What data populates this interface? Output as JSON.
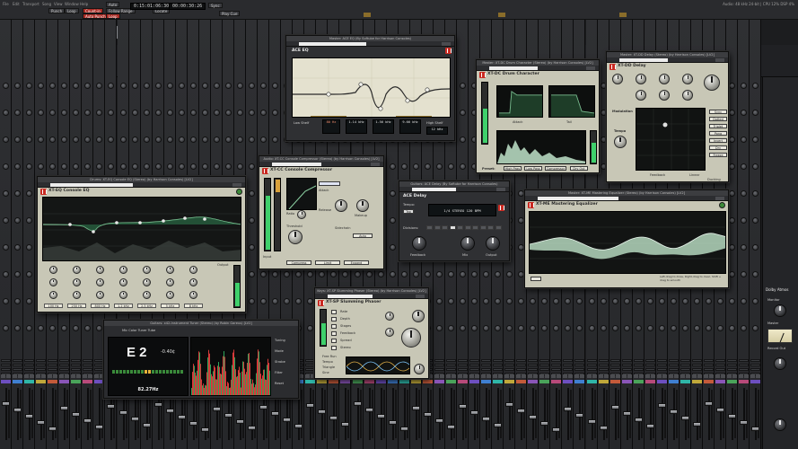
{
  "transport": {
    "menu": [
      "File",
      "Edit",
      "Transport",
      "Song",
      "View",
      "Window",
      "Help"
    ],
    "buttons": [
      "Punch",
      "Loop",
      "Count-in",
      "Auto",
      "Follow Range",
      "Auto Punch",
      "Loop",
      "Locate"
    ],
    "timecode": "0:15:01:06:30",
    "counter": "00:00:30:26",
    "sync_label": "Sync",
    "play_label": "Play Cue",
    "status_right": "Audio: 48 kHz 24-bit  |  CPU 12%   DSP 4%"
  },
  "plugins": {
    "ace_eq": {
      "title": "Master: ACE EQ (By Softube for Harrison Consoles)",
      "name": "ACE EQ",
      "bands": [
        "Low Shelf",
        "Bell",
        "Bell",
        "Bell",
        "High Shelf"
      ],
      "freqs": [
        "80 Hz",
        "1.14 kHz",
        "1.56 kHz",
        "9.66 kHz",
        "12 kHz"
      ]
    },
    "xt_dc": {
      "title": "Master: XT-DC Drum Character (Stereo) (by Harrison Consoles) [LV2]",
      "name": "XT-DC Drum Character",
      "labels": [
        "Attack",
        "Tail",
        "Preset:"
      ],
      "buttons": [
        "High Pass",
        "Low Pass",
        "Compressor",
        "Dry Out"
      ]
    },
    "xt_dd": {
      "title": "Master: XT-DD Delay (Stereo) (by Harrison Consoles) [LV2]",
      "name": "XT-DD Delay",
      "labels": [
        "Modulation",
        "Tempo",
        "Feedback",
        "Linear",
        "Ducking"
      ],
      "side_buttons": [
        "Sync",
        "Dotted",
        "Triplet",
        "Pong",
        "Invert",
        "Dry",
        "Freeze"
      ]
    },
    "xt_cc": {
      "title": "Audio: XT-CC Console Compressor (Stereo) (by Harrison Consoles) [LV2]",
      "name": "XT-CC Console Compressor",
      "labels": [
        "Ratio",
        "Attack",
        "Release",
        "Makeup",
        "Input",
        "Threshold",
        "Sidechain",
        "Auto"
      ],
      "footer": [
        "Compress",
        "Limit",
        "Expand"
      ]
    },
    "xt_eq": {
      "title": "Drums: XT-EQ Console EQ (Stereo) (by Harrison Consoles) [LV2]",
      "name": "XT-EQ Console EQ",
      "band_values": [
        "100 Hz",
        "250 Hz",
        "800 Hz",
        "1.2 kHz",
        "2.5 kHz",
        "5 kHz",
        "8 kHz",
        "12 kHz",
        "16 kHz",
        "18 kHz"
      ],
      "output_label": "Output"
    },
    "ace_delay": {
      "title": "Guitars: ACE Delay (By Softube for Harrison Consoles)",
      "name": "ACE Delay",
      "tempo_label": "Tempo:",
      "tap_label": "Tap",
      "display": "1/4 STEREO 120 BPM",
      "divisions_label": "Divisions:",
      "knob_labels": [
        "Feedback",
        "Mix",
        "Output"
      ]
    },
    "xt_me": {
      "title": "Master: XT-ME Mastering Equalizer (Stereo) (by Harrison Consoles) [LV2]",
      "name": "XT-ME Mastering Equalizer",
      "hint": "Left-drag to draw, Right-drag to clear, Shift + drag to smooth"
    },
    "xt_sp": {
      "title": "Keys: XT-SP Slumming Phaser (Stereo) (by Harrison Consoles) [LV2]",
      "name": "XT-SP Slumming Phaser",
      "labels": [
        "Rate",
        "Depth",
        "Stages",
        "Feedback",
        "Spread",
        "Stereo",
        "Mix",
        "Wet"
      ],
      "toggles": [
        "Free Run",
        "Tempo",
        "Triangle",
        "Sine"
      ]
    },
    "tuner": {
      "title": "Guitars: x42-Instrument Tuner (Stereo) (by Robin Gareus) [LV2]",
      "subtitle": "Mic Color Tuner Tube",
      "note": "E 2",
      "cents": "-0.40¢",
      "freq": "82.27Hz",
      "side": [
        "Tuning",
        "Mode",
        "Strobe",
        "Filter",
        "Reset"
      ]
    }
  },
  "colors": {
    "accent_red": "#c92a22",
    "eq_curve": "#8fd6a6",
    "tuner_spectrum": "#d63a3a",
    "meter_green": "#3fd06b",
    "panel": "#c8c7b6"
  },
  "right_panel": {
    "title": "Dolby Atmos",
    "items": [
      "Monitor",
      "Master",
      "Record Out"
    ]
  }
}
